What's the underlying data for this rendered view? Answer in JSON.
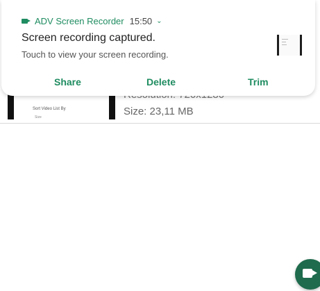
{
  "notification": {
    "app_name": "ADV Screen Recorder",
    "time": "15:50",
    "expand_glyph": "⌄",
    "title": "Screen recording captured.",
    "body": "Touch to view your screen recording.",
    "actions": {
      "share": "Share",
      "delete": "Delete",
      "trim": "Trim"
    },
    "accent_color": "#1f8c61"
  },
  "recording_item": {
    "thumb_text_1": "Sort Video List By",
    "thumb_text_2": "Size",
    "resolution": "Resolution: 720x1280",
    "size": "Size: 23,11 MB"
  },
  "fab": {
    "icon": "video-camera-icon",
    "color": "#1e6b4d"
  }
}
